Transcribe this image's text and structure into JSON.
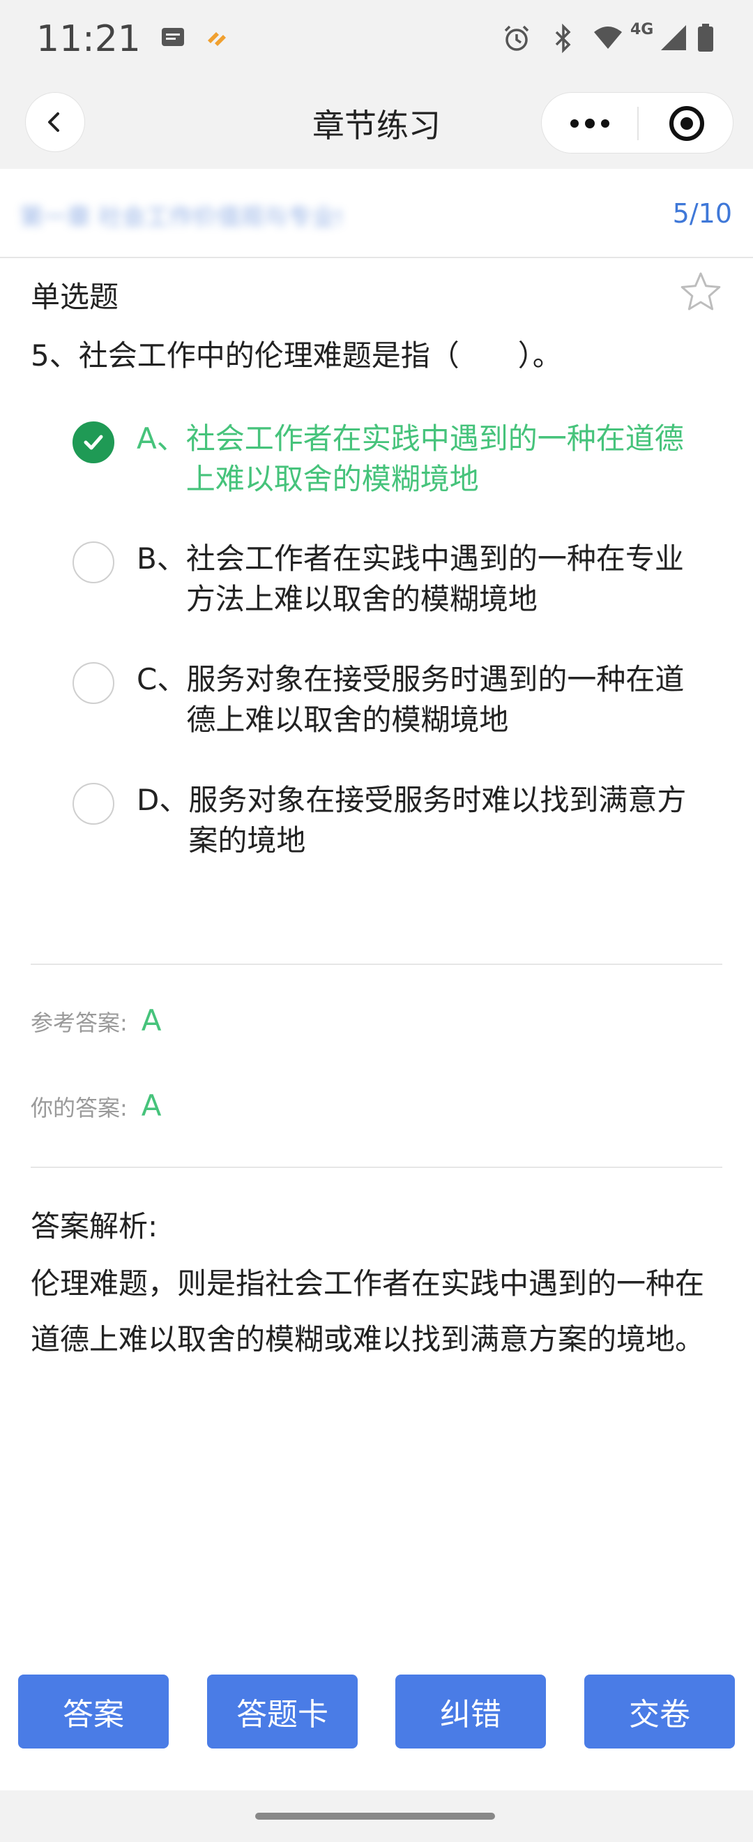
{
  "status_bar": {
    "time": "11:21",
    "network": "4G",
    "icons": [
      "message-icon",
      "app-notification-icon",
      "alarm-icon",
      "bluetooth-icon",
      "wifi-icon",
      "signal-icon",
      "battery-icon"
    ]
  },
  "header": {
    "title": "章节练习",
    "back_icon": "chevron-left-icon",
    "more_icon": "more-dots-icon",
    "close_icon": "target-circle-icon"
  },
  "progress": {
    "chapter_name": "第一章 社会工作价值观与专业伦理",
    "count": "5/10"
  },
  "question": {
    "type_label": "单选题",
    "star_icon": "star-outline-icon",
    "text": "5、社会工作中的伦理难题是指（　　）。",
    "options": [
      {
        "letter": "A、",
        "body": "社会工作者在实践中遇到的一种在道德上难以取舍的模糊境地",
        "selected": true
      },
      {
        "letter": "B、",
        "body": "社会工作者在实践中遇到的一种在专业方法上难以取舍的模糊境地",
        "selected": false
      },
      {
        "letter": "C、",
        "body": "服务对象在接受服务时遇到的一种在道德上难以取舍的模糊境地",
        "selected": false
      },
      {
        "letter": "D、",
        "body": "服务对象在接受服务时难以找到满意方案的境地",
        "selected": false
      }
    ]
  },
  "answer": {
    "reference_label": "参考答案:",
    "reference_value": "A",
    "yours_label": "你的答案:",
    "yours_value": "A"
  },
  "analysis": {
    "title": "答案解析:",
    "body": "伦理难题，则是指社会工作者在实践中遇到的一种在道德上难以取舍的模糊或难以找到满意方案的境地。"
  },
  "bottom_buttons": {
    "answer": "答案",
    "answer_card": "答题卡",
    "correct_error": "纠错",
    "submit": "交卷"
  },
  "colors": {
    "accent_blue": "#4a7ce6",
    "correct_green": "#46c37b",
    "check_green": "#1f9a55"
  }
}
